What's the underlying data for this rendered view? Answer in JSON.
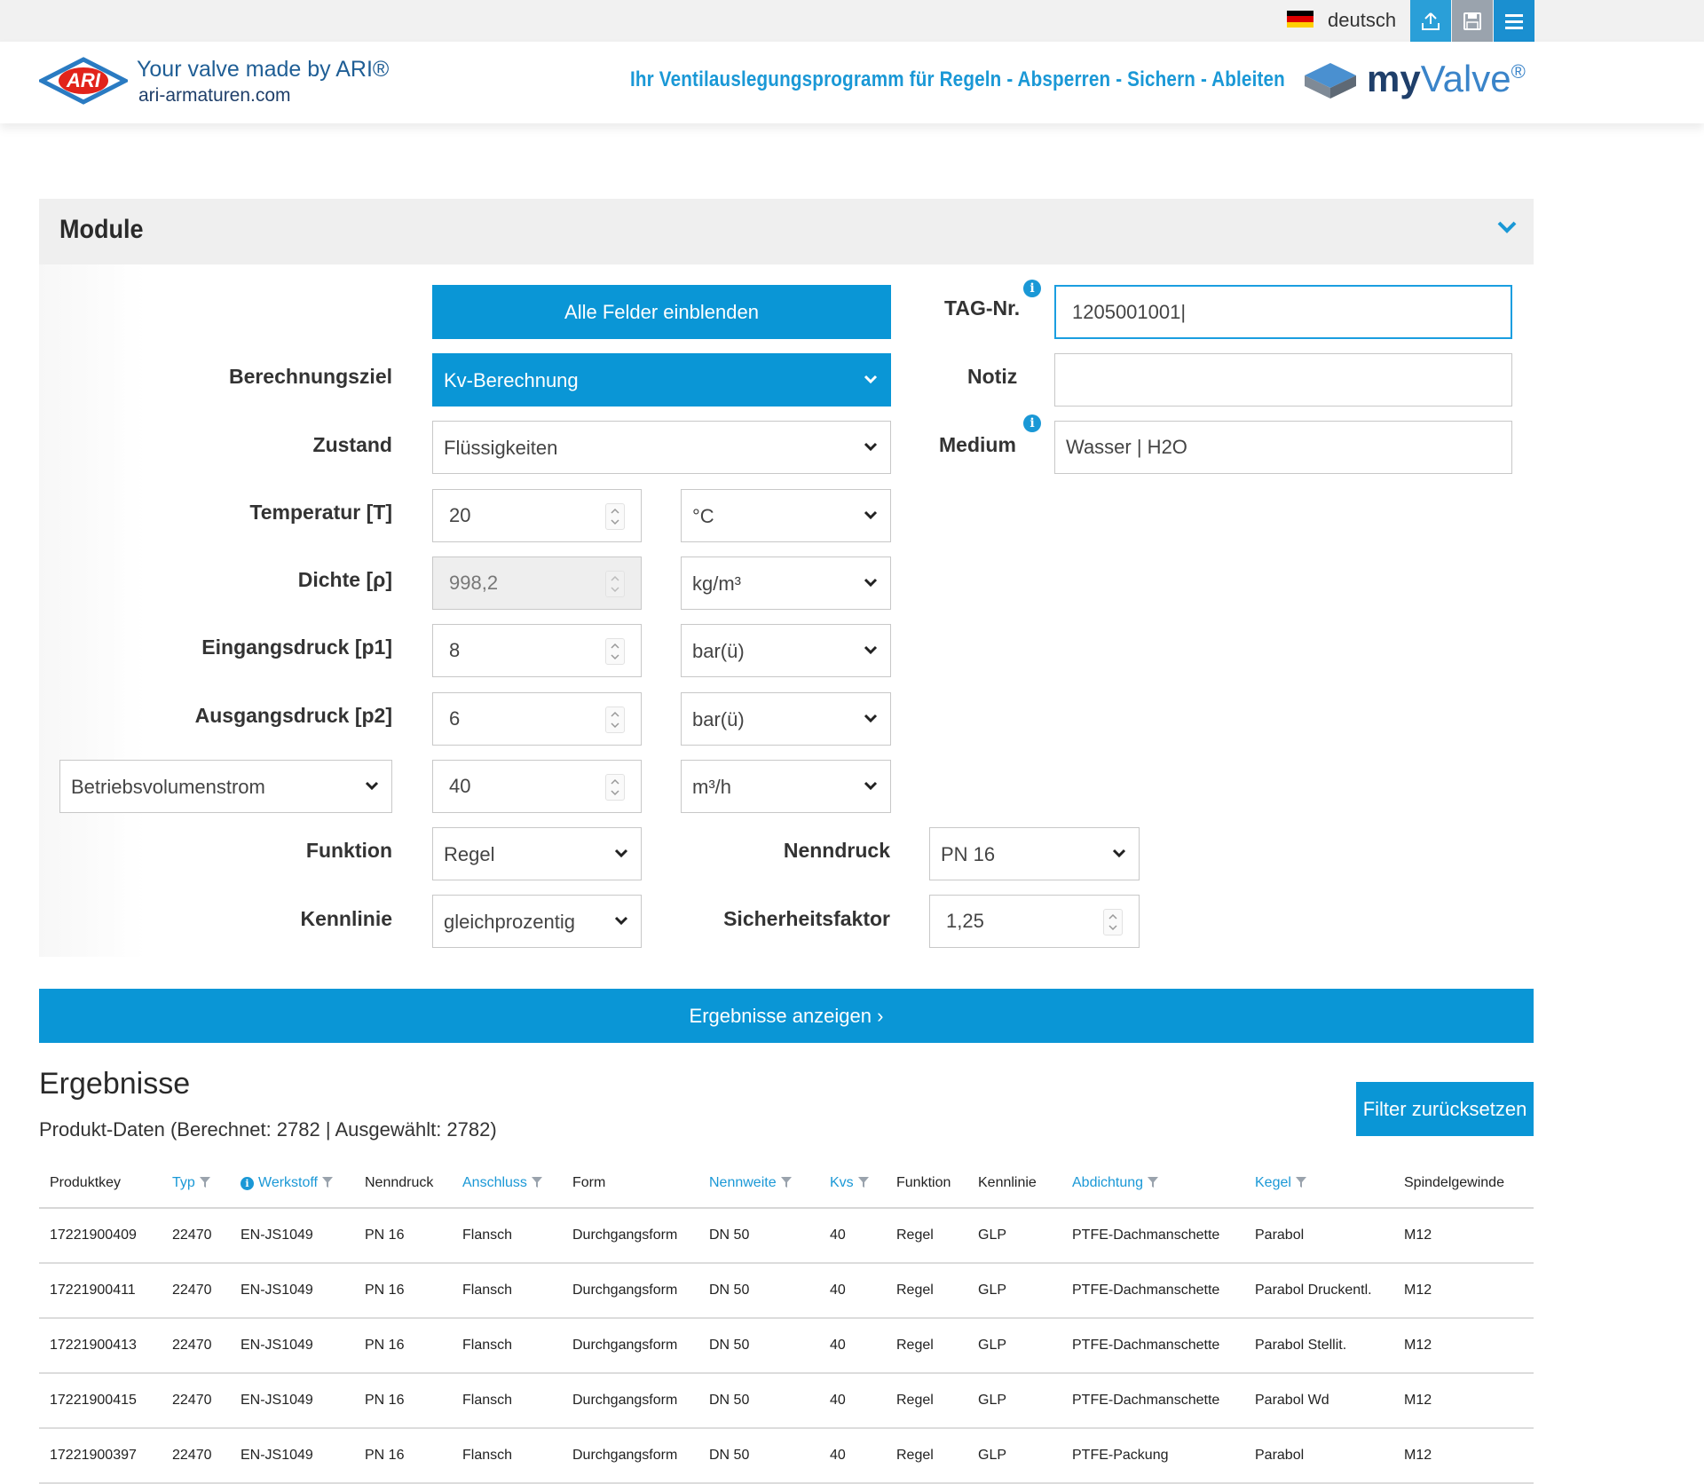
{
  "topbar": {
    "language": "deutsch"
  },
  "header": {
    "slogan": "Your valve made by ARI®",
    "site": "ari-armaturen.com",
    "tagline": "Ihr Ventilauslegungsprogramm für Regeln - Absperren - Sichern - Ableiten",
    "brand_prefix": "my",
    "brand_name": "Valve",
    "brand_mark": "®",
    "logo_text": "ARI"
  },
  "module": {
    "title": "Module",
    "show_all_button": "Alle Felder einblenden",
    "labels": {
      "tag": "TAG-Nr.",
      "notiz": "Notiz",
      "medium": "Medium",
      "berechnungsziel": "Berechnungsziel",
      "zustand": "Zustand",
      "temperatur": "Temperatur [T]",
      "dichte": "Dichte [ρ]",
      "eingangsdruck": "Eingangsdruck [p1]",
      "ausgangsdruck": "Ausgangsdruck [p2]",
      "funktion": "Funktion",
      "kennlinie": "Kennlinie",
      "nenndruck": "Nenndruck",
      "sicherheitsfaktor": "Sicherheitsfaktor"
    },
    "values": {
      "tag": "1205001001|",
      "notiz": "",
      "medium": "Wasser | H2O",
      "berechnungsziel": "Kv-Berechnung",
      "zustand": "Flüssigkeiten",
      "temperatur": "20",
      "temperatur_unit": "°C",
      "dichte": "998,2",
      "dichte_unit": "kg/m³",
      "eingangsdruck": "8",
      "eingangsdruck_unit": "bar(ü)",
      "ausgangsdruck": "6",
      "ausgangsdruck_unit": "bar(ü)",
      "volumenstrom_type": "Betriebsvolumenstrom",
      "volumenstrom": "40",
      "volumenstrom_unit": "m³/h",
      "funktion": "Regel",
      "kennlinie": "gleichprozentig",
      "nenndruck": "PN 16",
      "sicherheitsfaktor": "1,25"
    }
  },
  "results": {
    "show_button": "Ergebnisse anzeigen ›",
    "title": "Ergebnisse",
    "subtitle": "Produkt-Daten (Berechnet: 2782 | Ausgewählt: 2782)",
    "filter_reset": "Filter zurücksetzen",
    "columns": [
      "Produktkey",
      "Typ",
      "Werkstoff",
      "Nenndruck",
      "Anschluss",
      "Form",
      "Nennweite",
      "Kvs",
      "Funktion",
      "Kennlinie",
      "Abdichtung",
      "Kegel",
      "Spindelgewinde"
    ],
    "rows": [
      [
        "17221900409",
        "22470",
        "EN-JS1049",
        "PN 16",
        "Flansch",
        "Durchgangsform",
        "DN 50",
        "40",
        "Regel",
        "GLP",
        "PTFE-Dachmanschette",
        "Parabol",
        "M12"
      ],
      [
        "17221900411",
        "22470",
        "EN-JS1049",
        "PN 16",
        "Flansch",
        "Durchgangsform",
        "DN 50",
        "40",
        "Regel",
        "GLP",
        "PTFE-Dachmanschette",
        "Parabol Druckentl.",
        "M12"
      ],
      [
        "17221900413",
        "22470",
        "EN-JS1049",
        "PN 16",
        "Flansch",
        "Durchgangsform",
        "DN 50",
        "40",
        "Regel",
        "GLP",
        "PTFE-Dachmanschette",
        "Parabol Stellit.",
        "M12"
      ],
      [
        "17221900415",
        "22470",
        "EN-JS1049",
        "PN 16",
        "Flansch",
        "Durchgangsform",
        "DN 50",
        "40",
        "Regel",
        "GLP",
        "PTFE-Dachmanschette",
        "Parabol Wd",
        "M12"
      ],
      [
        "17221900397",
        "22470",
        "EN-JS1049",
        "PN 16",
        "Flansch",
        "Durchgangsform",
        "DN 50",
        "40",
        "Regel",
        "GLP",
        "PTFE-Packung",
        "Parabol",
        "M12"
      ]
    ]
  },
  "colors": {
    "accent": "#0a96d6",
    "brand_dark": "#1f3f6a",
    "panel": "#efefef"
  },
  "icons": {
    "upload": "upload-icon",
    "save": "save-icon",
    "menu": "menu-icon",
    "info": "info-icon",
    "filter": "filter-icon",
    "chevron": "chevron-down-icon"
  }
}
